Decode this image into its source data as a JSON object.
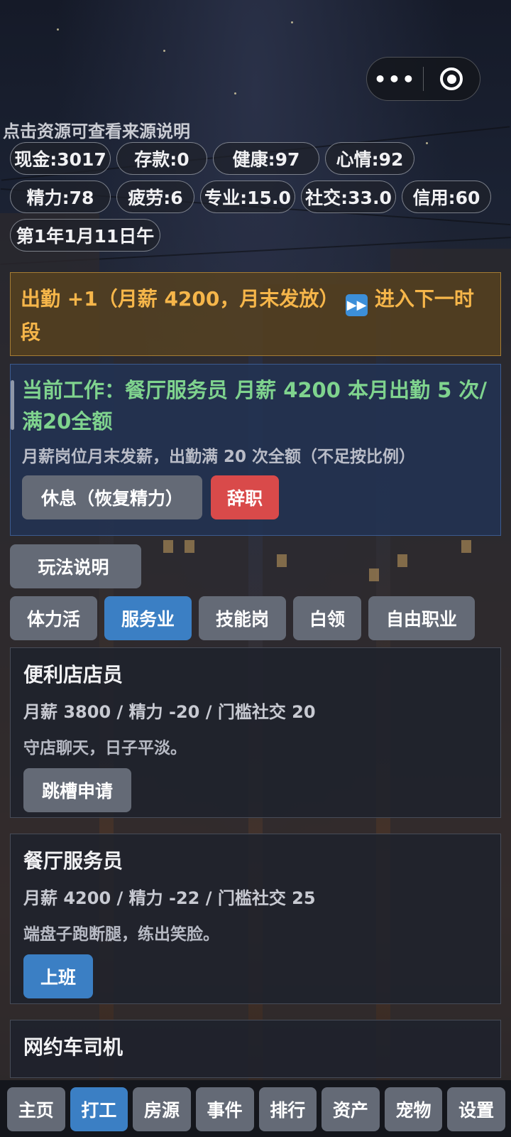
{
  "capsule": {
    "more_label": "•••"
  },
  "hint": "点击资源可查看来源说明",
  "resources": {
    "row1": [
      "现金:3017",
      "存款:0",
      "健康:97",
      "心情:92"
    ],
    "row2": [
      "精力:78",
      "疲劳:6",
      "专业:15.0",
      "社交:33.0",
      "信用:60"
    ],
    "row3": [
      "第1年1月11日午"
    ]
  },
  "notice": {
    "text": "出勤 +1（月薪 4200，月末发放）",
    "next_label": "进入下一时段"
  },
  "current_job": {
    "title": "当前工作：餐厅服务员  月薪 4200  本月出勤 5 次/满20全额",
    "desc": "月薪岗位月末发薪，出勤满 20 次全额（不足按比例）",
    "rest_label": "休息（恢复精力）",
    "quit_label": "辞职"
  },
  "guide_label": "玩法说明",
  "guide_glyph": "",
  "categories": [
    "体力活",
    "服务业",
    "技能岗",
    "白领",
    "自由职业"
  ],
  "active_category": 1,
  "jobs": [
    {
      "title": "便利店店员",
      "meta": "月薪 3800 / 精力 -20 / 门槛社交 20",
      "desc": "守店聊天，日子平淡。",
      "action": "跳槽申请",
      "primary": false
    },
    {
      "title": "餐厅服务员",
      "meta": "月薪 4200 / 精力 -22 / 门槛社交 25",
      "desc": "端盘子跑断腿，练出笑脸。",
      "action": "上班",
      "primary": true
    },
    {
      "title": "网约车司机"
    }
  ],
  "nav": [
    "主页",
    "打工",
    "房源",
    "事件",
    "排行",
    "资产",
    "宠物",
    "设置"
  ],
  "active_nav": 1,
  "colors": {
    "accent": "#3b7fc4",
    "danger": "#d94a4a",
    "notice": "#f6b64a",
    "job_green": "#7fd38e"
  }
}
